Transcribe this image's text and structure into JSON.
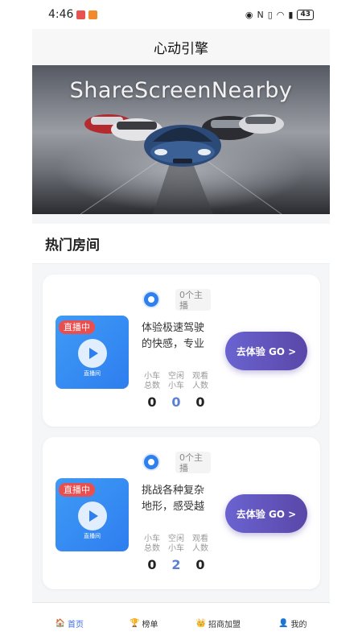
{
  "status_bar": {
    "time": "4:46",
    "battery": "43"
  },
  "header": {
    "title": "心动引擎"
  },
  "banner": {
    "text": "ShareScreenNearby"
  },
  "section": {
    "title": "热门房间"
  },
  "rooms": [
    {
      "live_badge": "直播中",
      "thumb_label": "直播间",
      "anchor_tag": "0个主播",
      "description": "体验极速驾驶的快感，专业",
      "stats": [
        {
          "label": "小车总数",
          "value": "0"
        },
        {
          "label": "空闲小车",
          "value": "0"
        },
        {
          "label": "观看人数",
          "value": "0"
        }
      ],
      "button_label": "去体验 GO >"
    },
    {
      "live_badge": "直播中",
      "thumb_label": "直播间",
      "anchor_tag": "0个主播",
      "description": "挑战各种复杂地形，感受越",
      "stats": [
        {
          "label": "小车总数",
          "value": "0"
        },
        {
          "label": "空闲小车",
          "value": "2"
        },
        {
          "label": "观看人数",
          "value": "0"
        }
      ],
      "button_label": "去体验 GO >"
    }
  ],
  "tabbar": {
    "items": [
      {
        "label": "首页",
        "icon": "home-icon"
      },
      {
        "label": "榜单",
        "icon": "trophy-icon"
      },
      {
        "label": "招商加盟",
        "icon": "crown-icon"
      },
      {
        "label": "我的",
        "icon": "user-icon"
      }
    ]
  },
  "colors": {
    "accent": "#3d6ee0",
    "button": "#5a47a8",
    "live": "#ea4f4f"
  }
}
